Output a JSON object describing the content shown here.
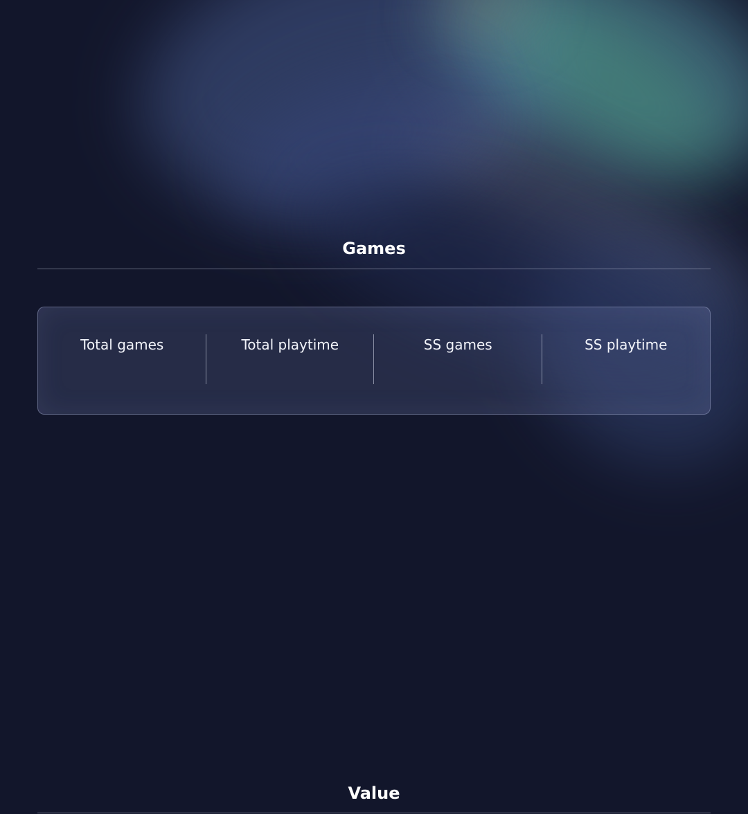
{
  "sections": {
    "games": {
      "title": "Games",
      "stats": [
        {
          "label": "Total games"
        },
        {
          "label": "Total playtime"
        },
        {
          "label": "SS games"
        },
        {
          "label": "SS playtime"
        }
      ]
    },
    "value": {
      "title": "Value"
    }
  },
  "theme": {
    "background": "#12162b",
    "text": "#ffffff"
  }
}
